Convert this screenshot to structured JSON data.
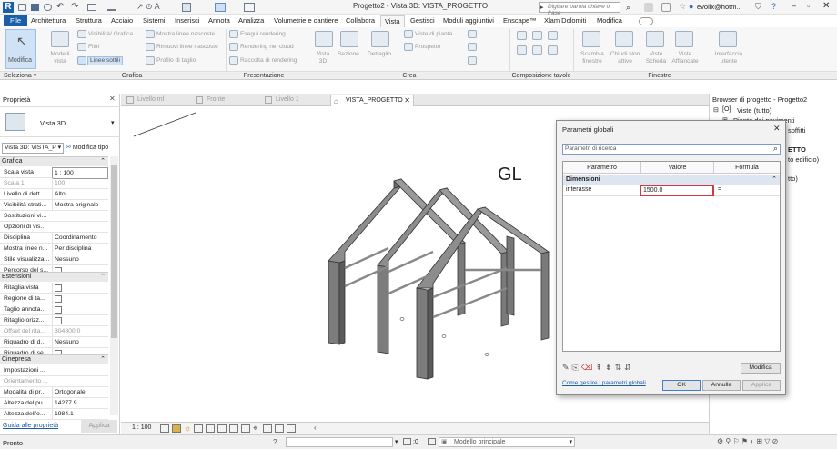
{
  "titlebar": {
    "title": "Progetto2 - Vista 3D: VISTA_PROGETTO",
    "search_placeholder": "Digitare parola chiave o frase",
    "user": "evolix@hotm..."
  },
  "menu": {
    "items": [
      "File",
      "Architettura",
      "Struttura",
      "Acciaio",
      "Sistemi",
      "Inserisci",
      "Annota",
      "Analizza",
      "Volumetrie e cantiere",
      "Collabora",
      "Vista",
      "Gestisci",
      "Moduli aggiuntivi",
      "Enscape™",
      "Xlam Dolomiti",
      "Modifica"
    ]
  },
  "ribbon": {
    "modifica": "Modifica",
    "seleziona": "Seleziona",
    "grafica": {
      "modelli_vista": "Modelli vista",
      "visibilita": "Visibilità/ Grafica",
      "filtri": "Filtri",
      "linee_sottili": "Linee sottili",
      "mostra_nascoste": "Mostra linee nascoste",
      "rimuovi_nascoste": "Rimuovi linee nascoste",
      "profilo_taglio": "Profilo di taglio",
      "label": "Grafica"
    },
    "presentazione": {
      "esegui_rendering": "Esegui rendering",
      "rendering_cloud": "Rendering nel cloud",
      "raccolta_rendering": "Raccolta di rendering",
      "label": "Presentazione"
    },
    "crea": {
      "vista3d": "Vista 3D",
      "sezione": "Sezione",
      "dettaglio": "Dettaglio",
      "viste_pianta": "Viste di pianta",
      "prospetto": "Prospetto",
      "label": "Crea"
    },
    "composizione": {
      "label": "Composizione tavole"
    },
    "finestre": {
      "scambia": "Scambia finestre",
      "chiudi": "Chiudi Non attive",
      "viste_scheda": "Viste Scheda",
      "viste_affiancate": "Viste Affiancate",
      "interfaccia": "Interfaccia utente",
      "label": "Finestre"
    }
  },
  "properties": {
    "header": "Proprietà",
    "type_name": "Vista 3D",
    "view_selector": "Vista 3D: VISTA_P",
    "modifica_tipo": "Modifica tipo",
    "sections": {
      "grafica": "Grafica",
      "estensioni": "Estensioni",
      "cinepresa": "Cinepresa"
    },
    "rows": [
      {
        "label": "Scala vista",
        "value": "1 : 100",
        "kind": "input"
      },
      {
        "label": "Scala  1:",
        "value": "100",
        "kind": "grey"
      },
      {
        "label": "Livello di dett...",
        "value": "Alto",
        "kind": "text"
      },
      {
        "label": "Visibilità strati...",
        "value": "Mostra originale",
        "kind": "text"
      },
      {
        "label": "Sostituzioni vi...",
        "value": "Modifica...",
        "kind": "button"
      },
      {
        "label": "Opzioni di vis...",
        "value": "Modifica...",
        "kind": "button"
      },
      {
        "label": "Disciplina",
        "value": "Coordinamento",
        "kind": "text"
      },
      {
        "label": "Mostra linee n...",
        "value": "Per disciplina",
        "kind": "text"
      },
      {
        "label": "Stile visualizza...",
        "value": "Nessuno",
        "kind": "text"
      },
      {
        "label": "Percorso del s...",
        "value": "",
        "kind": "check"
      }
    ],
    "rows2": [
      {
        "label": "Ritaglia vista",
        "value": "",
        "kind": "check"
      },
      {
        "label": "Regione di ta...",
        "value": "",
        "kind": "check"
      },
      {
        "label": "Taglio annota...",
        "value": "",
        "kind": "check"
      },
      {
        "label": "Ritaglio orizz...",
        "value": "",
        "kind": "check"
      },
      {
        "label": "Offset del rita...",
        "value": "304800.0",
        "kind": "grey"
      },
      {
        "label": "Riquadro di d...",
        "value": "Nessuno",
        "kind": "text"
      },
      {
        "label": "Riquadro di se...",
        "value": "",
        "kind": "check"
      }
    ],
    "rows3": [
      {
        "label": "Impostazioni ...",
        "value": "Modifica...",
        "kind": "button"
      },
      {
        "label": "Orientamento ...",
        "value": "",
        "kind": "grey"
      },
      {
        "label": "Modalità di pr...",
        "value": "Ortogonale",
        "kind": "text"
      },
      {
        "label": "Altezza del pu...",
        "value": "14277.9",
        "kind": "text"
      },
      {
        "label": "Altezza dell'o...",
        "value": "1984.1",
        "kind": "text"
      }
    ],
    "help_link": "Guida alle proprietà",
    "apply": "Applica"
  },
  "doctabs": [
    "Livello ml",
    "Fronte",
    "Livello 1",
    "VISTA_PROGETTO"
  ],
  "viewport": {
    "gl_label": "GL"
  },
  "viewbar": {
    "scale": "1 : 100"
  },
  "browser": {
    "header": "Browser di progetto - Progetto2",
    "items": [
      "Viste (tutto)",
      "Piante dei pavimenti",
      "soffitti",
      "ETTO",
      "to edificio)",
      "tto)"
    ]
  },
  "dialog": {
    "title": "Parametri globali",
    "search_placeholder": "Parametri di ricerca",
    "columns": [
      "Parametro",
      "Valore",
      "Formula"
    ],
    "group": "Dimensioni",
    "row": {
      "name": "interasse",
      "value": "1500.0",
      "formula": "="
    },
    "modify": "Modifica",
    "help_link": "Come gestire i parametri globali",
    "ok": "OK",
    "cancel": "Annulla",
    "apply": "Applica"
  },
  "statusbar": {
    "left": "Pronto",
    "coord": ":0",
    "model": "Modello principale"
  },
  "colors": {
    "file_tab": "#1a5fa8",
    "accent": "#1a5fa8",
    "highlight": "#d3393f"
  }
}
